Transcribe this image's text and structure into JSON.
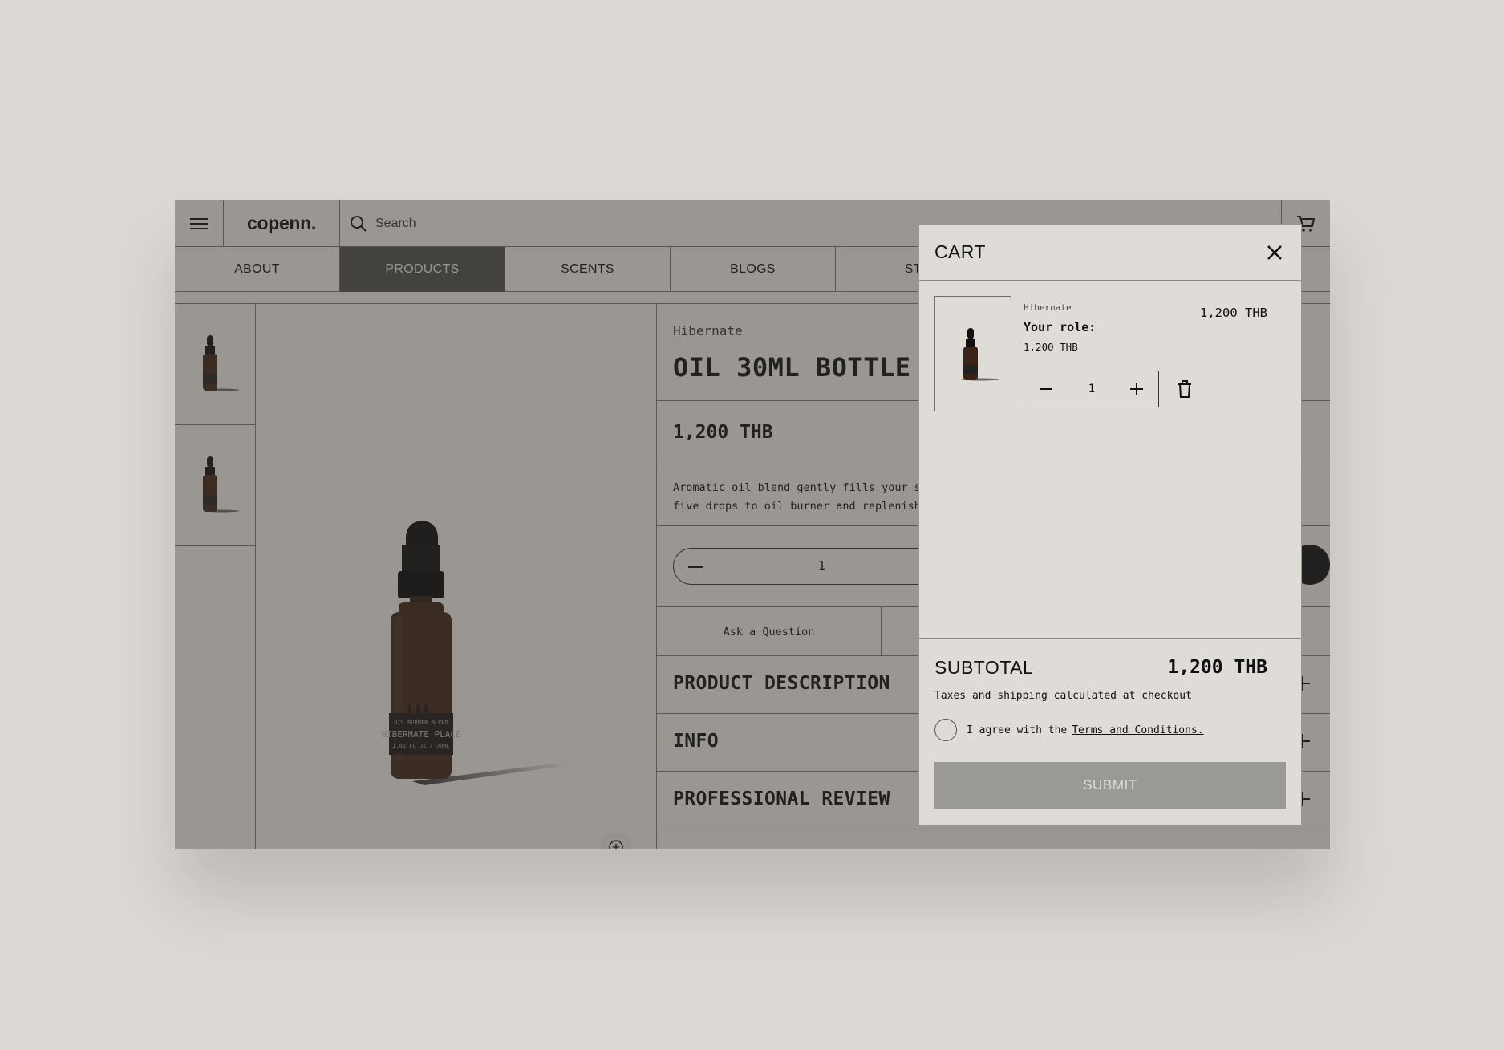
{
  "header": {
    "logo": "copenn.",
    "search_placeholder": "Search"
  },
  "nav": {
    "items": [
      "ABOUT",
      "PRODUCTS",
      "SCENTS",
      "BLOGS",
      "STO"
    ],
    "active": "PRODUCTS"
  },
  "product": {
    "brand": "Hibernate",
    "title": "OIL 30ML BOTTLE",
    "price": "1,200 THB",
    "description_line1": "Aromatic oil blend gently fills your sp",
    "description_line2": "five drops to oil burner and replenish",
    "quantity": "1",
    "ask_question": "Ask a Question",
    "sections": [
      "PRODUCT DESCRIPTION",
      "INFO",
      "PROFESSIONAL REVIEW"
    ],
    "label_line1": "OIL BURNER BLEND",
    "label_line2": "HIBERNATE PLACE",
    "label_line3": "1.01 FL OZ / 30ML"
  },
  "cart": {
    "title": "CART",
    "item": {
      "brand": "Hibernate",
      "role_label": "Your role:",
      "sub_price": "1,200 THB",
      "price": "1,200 THB",
      "quantity": "1"
    },
    "subtotal_label": "SUBTOTAL",
    "subtotal_value": "1,200 THB",
    "tax_note": "Taxes and shipping calculated at checkout",
    "agree_text": "I agree with the",
    "terms_link": "Terms and Conditions.",
    "submit_label": "SUBMIT"
  },
  "colors": {
    "background": "#dcd9d4",
    "nav_active": "#4a4946",
    "submit_disabled": "#9b9994",
    "bottle": "#4a2a1a"
  },
  "icons": [
    "hamburger-icon",
    "search-icon",
    "cart-icon",
    "close-icon",
    "minus-icon",
    "plus-icon",
    "trash-icon",
    "zoom-in-icon"
  ]
}
